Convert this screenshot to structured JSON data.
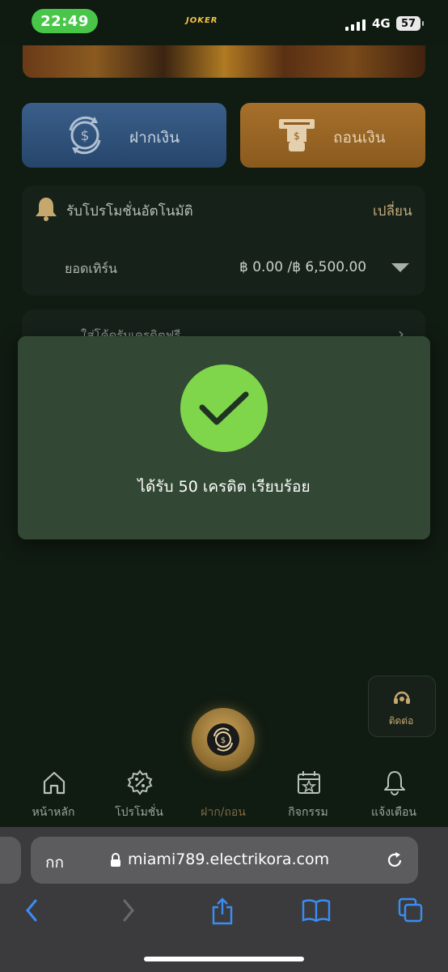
{
  "status_bar": {
    "time": "22:49",
    "network": "4G",
    "battery": "57"
  },
  "banner": {
    "logo_text": "JOKER"
  },
  "actions": {
    "deposit_label": "ฝากเงิน",
    "withdraw_label": "ถอนเงิน"
  },
  "promo": {
    "title": "รับโปรโมชั่นอัตโนมัติ",
    "change_label": "เปลี่ยน",
    "turnover_label": "ยอดเทิร์น",
    "turnover_value": "฿ 0.00 /฿ 6,500.00"
  },
  "code_card": {
    "label": "ใส่โค้ดรับเครดิตฟรี"
  },
  "modal": {
    "message": "ได้รับ 50 เครดิต เรียบร้อย"
  },
  "chat": {
    "label": "ติดต่อ"
  },
  "bottom_nav": {
    "items": [
      {
        "label": "หน้าหลัก",
        "icon": "home-icon"
      },
      {
        "label": "โปรโมชั่น",
        "icon": "promotion-badge-icon"
      },
      {
        "label": "ฝาก/ถอน",
        "icon": "deposit-withdraw-icon"
      },
      {
        "label": "กิจกรรม",
        "icon": "calendar-star-icon"
      },
      {
        "label": "แจ้งเตือน",
        "icon": "bell-icon"
      }
    ]
  },
  "browser": {
    "aa_label": "กก",
    "url": "miami789.electrikora.com"
  },
  "colors": {
    "success_green": "#7fd64b",
    "modal_bg": "#324834",
    "deposit_blue": "#3a5f8a",
    "withdraw_orange": "#a6702b",
    "accent_gold": "#c6a86e",
    "ios_blue": "#3a8df5"
  }
}
